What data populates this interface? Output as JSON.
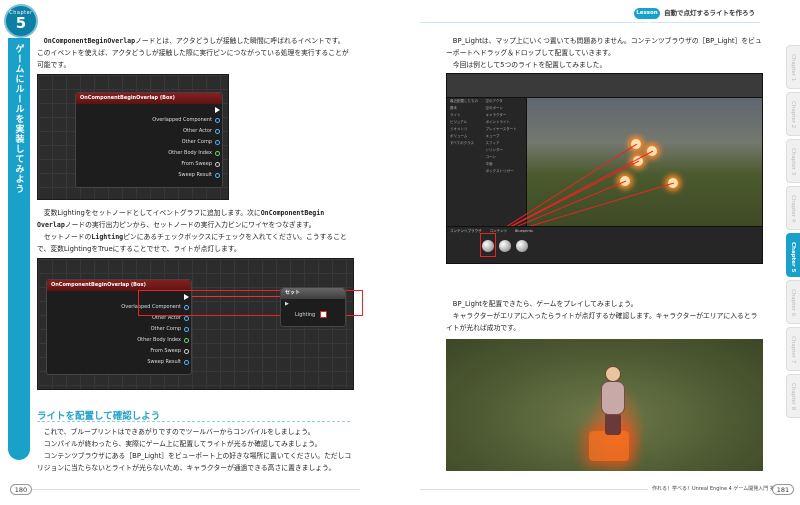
{
  "chapter": {
    "label": "Chapter",
    "number": "5",
    "strip_title": "ゲームにルールを実装してみよう"
  },
  "header": {
    "lesson_tag": "Lesson 14",
    "lesson_title": "自動で点灯するライトを作ろう"
  },
  "right_tabs": [
    "Chapter 1",
    "Chapter 2",
    "Chapter 3",
    "Chapter 4",
    "Chapter 5",
    "Chapter 6",
    "Chapter 7",
    "Chapter 8"
  ],
  "left_page": {
    "para1": {
      "a": "OnComponentBeginOverlap",
      "b": "ノードとは、アクタどうしが接触した瞬間に呼ばれるイベントです。",
      "c": "このイベントを使えば、アクタどうしが接触した際に実行ピンにつながっている処理を実行することが",
      "d": "可能です。"
    },
    "node1": {
      "title": "OnComponentBeginOverlap (Box)",
      "pins": [
        "Overlapped Component",
        "Other Actor",
        "Other Comp",
        "Other Body Index",
        "From Sweep",
        "Sweep Result"
      ]
    },
    "para2": {
      "l1a": "変数Lightingをセットノードとしてイベントグラフに追加します。次に",
      "l1b": "OnComponentBegin",
      "l2a": "Overlap",
      "l2b": "ノードの実行出力ピンから、セットノードの実行入力ピンにワイヤをつなぎます。",
      "l3a": "セットノードの",
      "l3b": "Lighting",
      "l3c": "ピンにあるチェックボックスにチェックを入れてください。こうすること",
      "l4": "で、変数LightingをTrueにすることでせで、ライトが点灯します。"
    },
    "node2": {
      "title": "OnComponentBeginOverlap (Box)",
      "pins": [
        "Overlapped Component",
        "Other Actor",
        "Other Comp",
        "Other Body Index",
        "From Sweep",
        "Sweep Result"
      ],
      "set_title": "セット",
      "set_pin": "Lighting"
    },
    "section_title": "ライトを配置して確認しよう",
    "para3": {
      "l1": "これで、ブループリントはできあがりですのでツールバーからコンパイルをしましょう。",
      "l2": "コンパイルが終わったら、実際にゲーム上に配置してライトが光るか確認してみましょう。",
      "l3": "コンテンツブラウザにある［BP_Light］をビューポート上の好きな場所に置いてください。ただしコ",
      "l4": "リジョンに当たらないとライトが光らないため、キャラクターが通過できる高さに置きましょう。"
    },
    "page_number": "180"
  },
  "right_page": {
    "para1": {
      "l1": "BP_Lightは、マップ上にいくつ置いても問題ありません。コンテンツブラウザの［BP_Light］をビュ",
      "l2": "ーポートへドラッグ＆ドロップして配置していきます。",
      "l3": "今回は例として5つのライトを配置してみました。"
    },
    "editor": {
      "left_items": [
        "最近配置したもの",
        "基本",
        "ライト",
        "ビジュアル",
        "ジオメトリ",
        "ボリューム",
        "すべてのクラス"
      ],
      "place_items": [
        "空のアクタ",
        "空のポーン",
        "キャラクター",
        "ポイントライト",
        "プレイヤースタート",
        "キューブ",
        "スフィア",
        "シリンダー",
        "コーン",
        "平面",
        "ボックストリガー"
      ],
      "bottom_tabs": [
        "コンテンツブラウザ",
        "コンテンツ",
        "Blueprints"
      ]
    },
    "para2": {
      "l1": "BP_Lightを配置できたら、ゲームをプレイしてみましょう。",
      "l2": "キャラクターがエリアに入ったらライトが点灯するか確認します。キャラクターがエリアに入るとラ",
      "l3": "イトが光れば成功です。"
    },
    "footer_text": "作れる！学べる！Unreal Engine 4 ゲーム開発入門 第2版",
    "page_number": "181"
  }
}
